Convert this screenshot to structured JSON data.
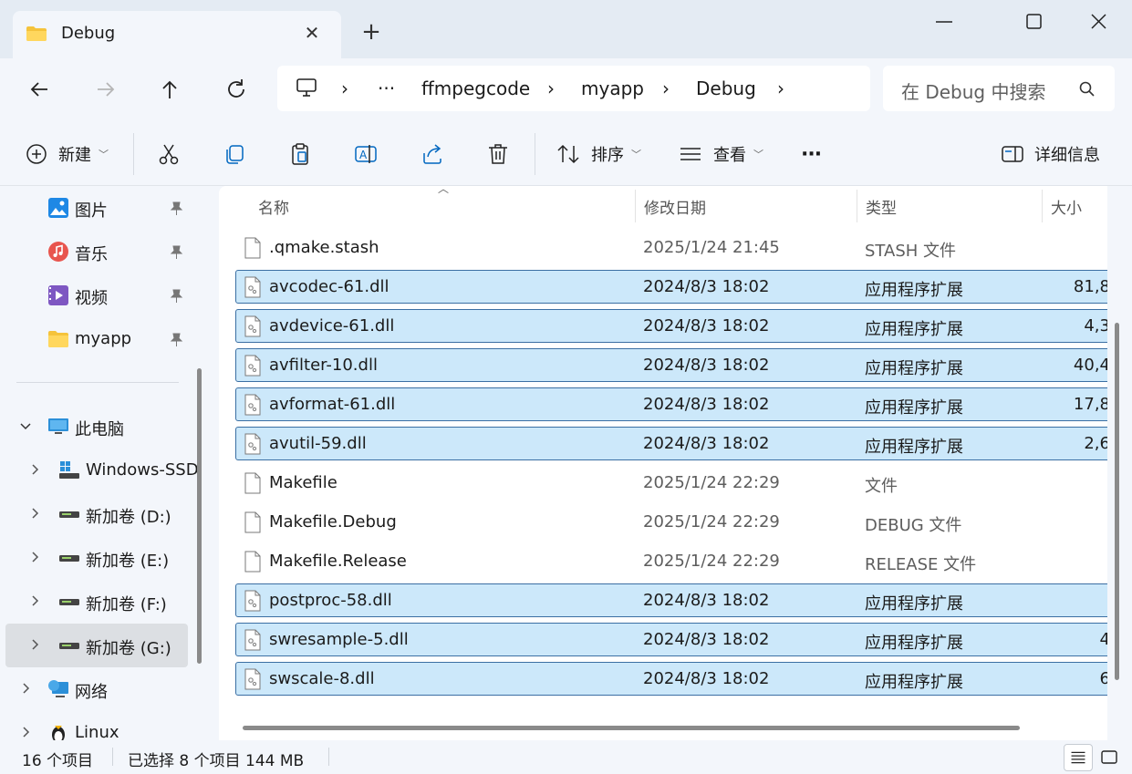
{
  "window": {
    "tab_title": "Debug",
    "tab_close_icon": "close-icon",
    "new_tab_icon": "plus-icon"
  },
  "nav": {
    "breadcrumb": [
      "···",
      "ffmpegcode",
      "myapp",
      "Debug"
    ],
    "search_placeholder": "在 Debug 中搜索"
  },
  "commandbar": {
    "new_label": "新建",
    "sort_label": "排序",
    "view_label": "查看",
    "more_label": "···",
    "details_label": "详细信息"
  },
  "sidebar": {
    "quick": [
      {
        "label": "图片",
        "icon": "pictures-icon"
      },
      {
        "label": "音乐",
        "icon": "music-icon"
      },
      {
        "label": "视频",
        "icon": "video-icon"
      },
      {
        "label": "myapp",
        "icon": "folder-icon"
      }
    ],
    "this_pc": "此电脑",
    "drives": [
      {
        "label": "Windows-SSD",
        "icon": "windows-drive-icon"
      },
      {
        "label": "新加卷 (D:)",
        "icon": "drive-icon"
      },
      {
        "label": "新加卷 (E:)",
        "icon": "drive-icon"
      },
      {
        "label": "新加卷 (F:)",
        "icon": "drive-icon"
      },
      {
        "label": "新加卷 (G:)",
        "icon": "drive-icon"
      }
    ],
    "network": "网络",
    "linux": "Linux"
  },
  "columns": {
    "name": "名称",
    "modified": "修改日期",
    "type": "类型",
    "size": "大小"
  },
  "files": [
    {
      "name": ".qmake.stash",
      "date": "2025/1/24 21:45",
      "type": "STASH 文件",
      "size": "",
      "selected": false,
      "icon": "file-icon"
    },
    {
      "name": "avcodec-61.dll",
      "date": "2024/8/3 18:02",
      "type": "应用程序扩展",
      "size": "81,8",
      "selected": true,
      "icon": "dll-icon"
    },
    {
      "name": "avdevice-61.dll",
      "date": "2024/8/3 18:02",
      "type": "应用程序扩展",
      "size": "4,3",
      "selected": true,
      "icon": "dll-icon"
    },
    {
      "name": "avfilter-10.dll",
      "date": "2024/8/3 18:02",
      "type": "应用程序扩展",
      "size": "40,4",
      "selected": true,
      "icon": "dll-icon"
    },
    {
      "name": "avformat-61.dll",
      "date": "2024/8/3 18:02",
      "type": "应用程序扩展",
      "size": "17,8",
      "selected": true,
      "icon": "dll-icon"
    },
    {
      "name": "avutil-59.dll",
      "date": "2024/8/3 18:02",
      "type": "应用程序扩展",
      "size": "2,6",
      "selected": true,
      "icon": "dll-icon"
    },
    {
      "name": "Makefile",
      "date": "2025/1/24 22:29",
      "type": "文件",
      "size": "",
      "selected": false,
      "icon": "file-icon"
    },
    {
      "name": "Makefile.Debug",
      "date": "2025/1/24 22:29",
      "type": "DEBUG 文件",
      "size": "",
      "selected": false,
      "icon": "file-icon"
    },
    {
      "name": "Makefile.Release",
      "date": "2025/1/24 22:29",
      "type": "RELEASE 文件",
      "size": "",
      "selected": false,
      "icon": "file-icon"
    },
    {
      "name": "postproc-58.dll",
      "date": "2024/8/3 18:02",
      "type": "应用程序扩展",
      "size": "",
      "selected": true,
      "icon": "dll-icon"
    },
    {
      "name": "swresample-5.dll",
      "date": "2024/8/3 18:02",
      "type": "应用程序扩展",
      "size": "4",
      "selected": true,
      "icon": "dll-icon"
    },
    {
      "name": "swscale-8.dll",
      "date": "2024/8/3 18:02",
      "type": "应用程序扩展",
      "size": "6",
      "selected": true,
      "icon": "dll-icon"
    }
  ],
  "status": {
    "item_count": "16 个项目",
    "selection": "已选择 8 个项目 144 MB"
  },
  "colors": {
    "accent": "#0067c0",
    "selection_bg": "#cce8fa",
    "selection_border": "#3b6fa3",
    "chrome_bg": "#f3f6fb"
  }
}
